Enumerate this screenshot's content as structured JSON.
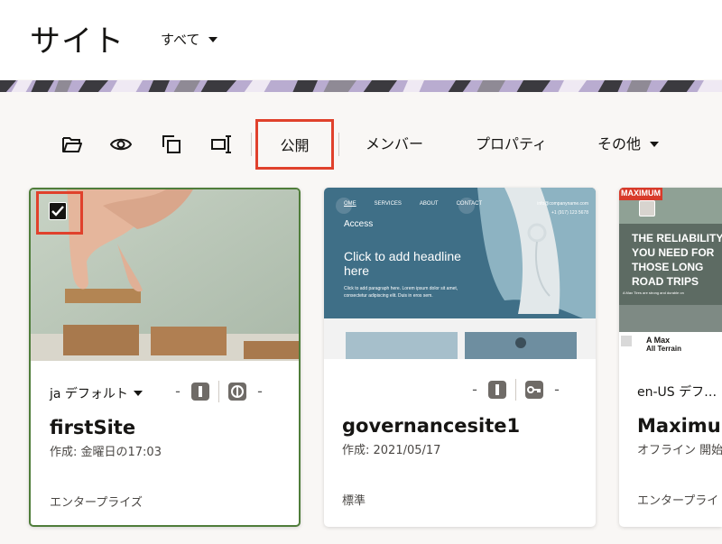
{
  "header": {
    "title": "サイト",
    "filter_label": "すべて"
  },
  "toolbar": {
    "publish_label": "公開",
    "members_label": "メンバー",
    "properties_label": "プロパティ",
    "more_label": "その他",
    "icons": [
      "folder-open-icon",
      "eye-icon",
      "copy-icon",
      "rename-icon"
    ]
  },
  "cards": [
    {
      "language": "ja デフォルト",
      "name": "firstSite",
      "created": "作成: 金曜日の17:03",
      "tier": "エンタープライズ",
      "selected": true
    },
    {
      "thumb": {
        "nav": [
          "OME",
          "SERVICES",
          "ABOUT",
          "CONTACT"
        ],
        "email": "info@companyname.com",
        "phone": "+1 (917) 123 5678",
        "subtitle": "Access",
        "headline_1": "Click to add headline",
        "headline_2": "here",
        "para_1": "Click to add paragraph here. Lorem ipsum dolor sit amet,",
        "para_2": "consectetur adipiscing elit. Duis in eros sem."
      },
      "name": "governancesite1",
      "created": "作成: 2021/05/17",
      "tier": "標準",
      "selected": false
    },
    {
      "thumb": {
        "brand": "MAXIMUM",
        "headline": [
          "THE RELIABILITY",
          "YOU NEED FOR",
          "THOSE LONG",
          "ROAD TRIPS"
        ],
        "caption_1": "A Max",
        "caption_2": "All Terrain",
        "body_text": "A Max Tires are strong and durable on"
      },
      "language": "en-US デフ…",
      "name": "Maximum",
      "created": "オフライン 開始",
      "tier": "エンタープライ",
      "selected": false
    }
  ]
}
